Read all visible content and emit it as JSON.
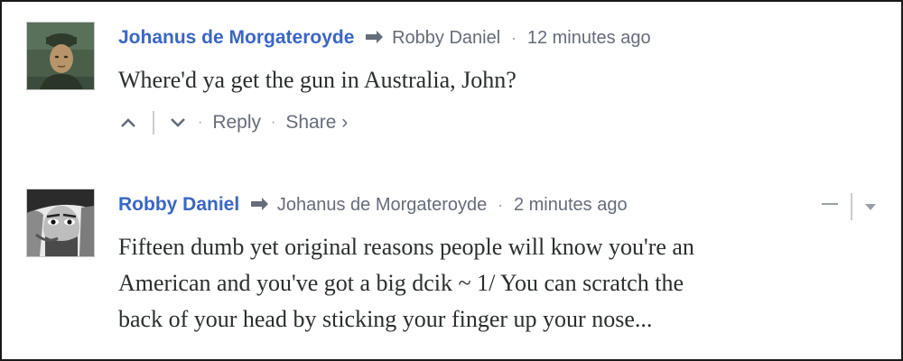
{
  "comments": [
    {
      "author": "Johanus de Morgateroyde",
      "reply_to": "Robby Daniel",
      "separator": "·",
      "time": "12 minutes ago",
      "lines": [
        "Where'd ya get the gun in Australia, John?"
      ],
      "reply_label": "Reply",
      "share_label": "Share ›",
      "dot": "·"
    },
    {
      "author": "Robby Daniel",
      "reply_to": "Johanus de Morgateroyde",
      "separator": "·",
      "time": "2 minutes ago",
      "lines": [
        "Fifteen dumb yet original reasons people will know you're an",
        "American and you've got a big dcik ~ 1/ You can scratch the",
        "back of your head by sticking your finger up your nose..."
      ]
    }
  ],
  "icons": {
    "reply_arrow": "reply-arrow-icon",
    "upvote": "chevron-up-icon",
    "downvote": "chevron-down-icon",
    "collapse": "minus-icon",
    "menu": "caret-down-icon"
  },
  "colors": {
    "author": "#3a66c4",
    "meta": "#656c7a",
    "text": "#2a2e2e"
  }
}
